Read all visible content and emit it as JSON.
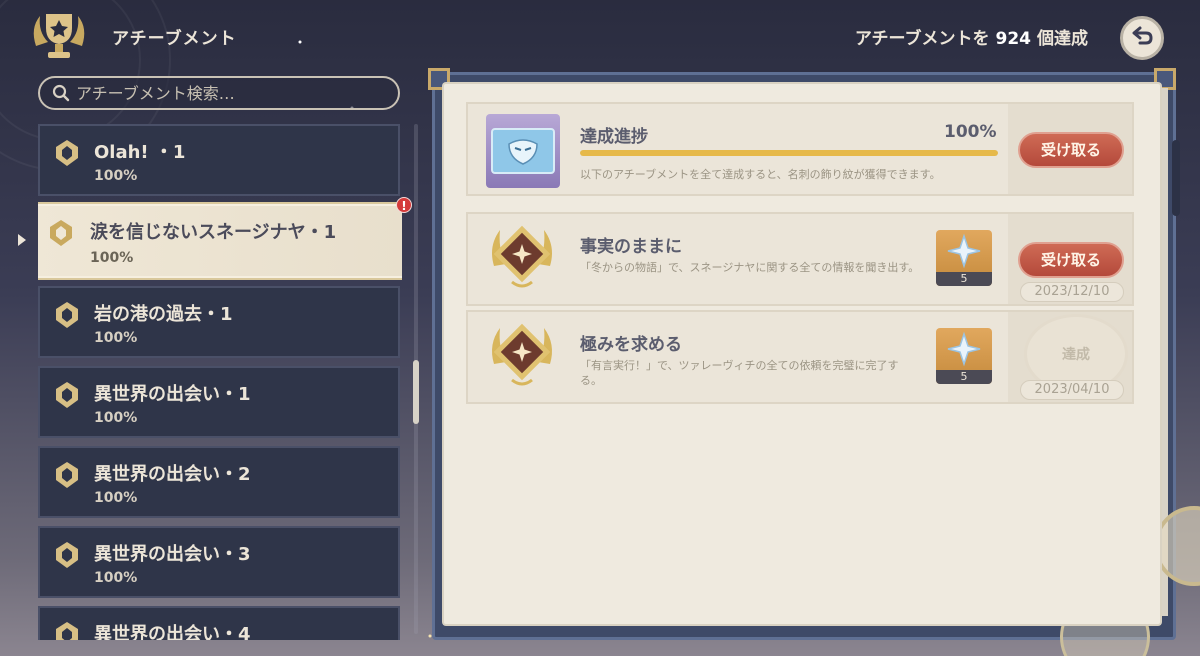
{
  "header": {
    "title": "アチーブメント",
    "count_prefix": "アチーブメントを",
    "count_value": "924",
    "count_suffix": "個達成"
  },
  "search": {
    "placeholder": "アチーブメント検索…"
  },
  "categories": [
    {
      "name": "Olah! ・1",
      "percent": "100%",
      "selected": false
    },
    {
      "name": "涙を信じないスネージナヤ・1",
      "percent": "100%",
      "selected": true
    },
    {
      "name": "岩の港の過去・1",
      "percent": "100%",
      "selected": false
    },
    {
      "name": "異世界の出会い・1",
      "percent": "100%",
      "selected": false
    },
    {
      "name": "異世界の出会い・2",
      "percent": "100%",
      "selected": false
    },
    {
      "name": "異世界の出会い・3",
      "percent": "100%",
      "selected": false
    },
    {
      "name": "異世界の出会い・4",
      "percent": "",
      "selected": false
    }
  ],
  "notification_badge": "!",
  "progress": {
    "title": "達成進捗",
    "percent_label": "100%",
    "fraction": 1.0,
    "description": "以下のアチーブメントを全て達成すると、名刺の飾り紋が獲得できます。",
    "claim_label": "受け取る"
  },
  "achievements": [
    {
      "title": "事実のままに",
      "description": "「冬からの物語」で、スネージナヤに関する全ての情報を聞き出す。",
      "reward_count": "5",
      "action_label": "受け取る",
      "date": "2023/12/10"
    },
    {
      "title": "極みを求める",
      "description": "「有言実行！」で、ツァレーヴィチの全ての依頼を完璧に完了する。",
      "reward_count": "5",
      "stamp_label": "達成",
      "date": "2023/04/10"
    }
  ],
  "colors": {
    "accent_gold": "#e6b94a",
    "claim_button": "#b4493b",
    "panel_bg": "#efeadf",
    "list_item_bg": "#2f3549"
  }
}
